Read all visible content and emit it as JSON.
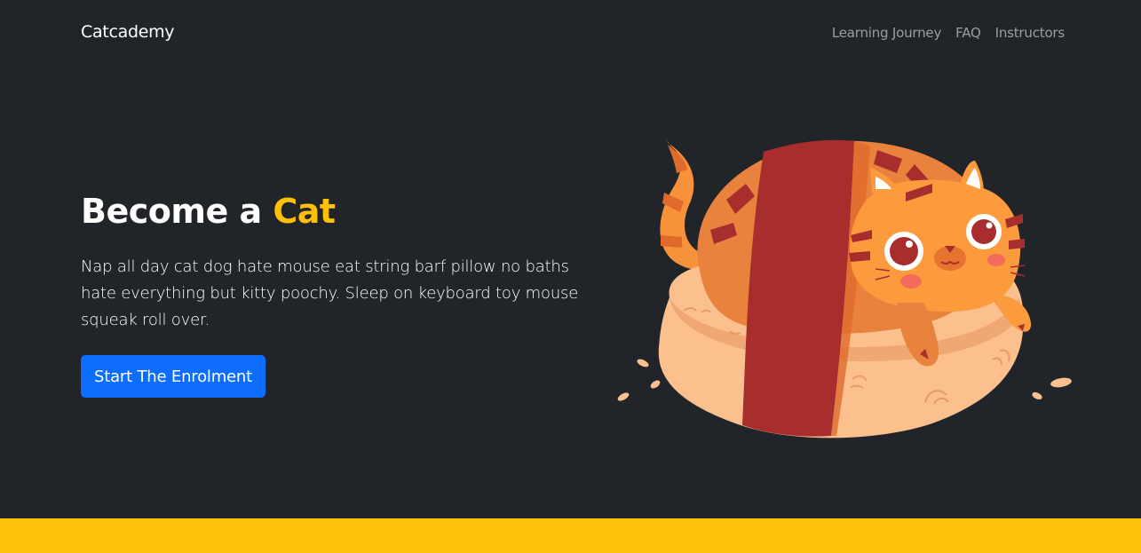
{
  "navbar": {
    "brand": "Catcademy",
    "links": [
      "Learning Journey",
      "FAQ",
      "Instructors"
    ]
  },
  "hero": {
    "title_prefix": "Become a ",
    "title_accent": "Cat",
    "lead": "Nap all day cat dog hate mouse eat string barf pillow no baths hate everything but kitty poochy. Sleep on keyboard toy mouse squeak roll over.",
    "cta_label": "Start The Enrolment",
    "image": "cat-on-bread-illustration"
  },
  "colors": {
    "background": "#212529",
    "accent": "#ffc107",
    "primary": "#0d6efd",
    "cat_orange": "#f7913a",
    "stripe_red": "#a82e2e",
    "bread": "#fbc08d"
  }
}
